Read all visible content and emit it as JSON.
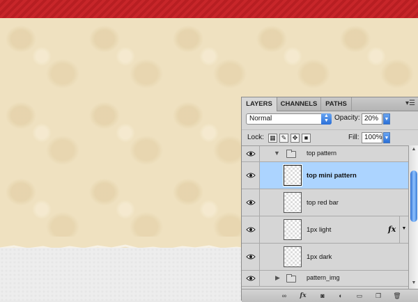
{
  "tabs": [
    "LAYERS",
    "CHANNELS",
    "PATHS"
  ],
  "blend_mode": "Normal",
  "opacity_label": "Opacity:",
  "opacity_value": "20%",
  "lock_label": "Lock:",
  "fill_label": "Fill:",
  "fill_value": "100%",
  "layers": [
    {
      "name": "top pattern",
      "type": "group",
      "expanded": true
    },
    {
      "name": "top mini pattern",
      "type": "layer",
      "selected": true
    },
    {
      "name": "top red bar",
      "type": "layer"
    },
    {
      "name": "1px light",
      "type": "layer",
      "fx": true
    },
    {
      "name": "1px dark",
      "type": "layer"
    },
    {
      "name": "pattern_img",
      "type": "group",
      "expanded": false
    }
  ],
  "fx_label": "fx",
  "colors": {
    "red_bar": "#c8262a",
    "paper": "#efe1c0",
    "selection": "#acd4ff",
    "panel": "#d6d6d6"
  }
}
